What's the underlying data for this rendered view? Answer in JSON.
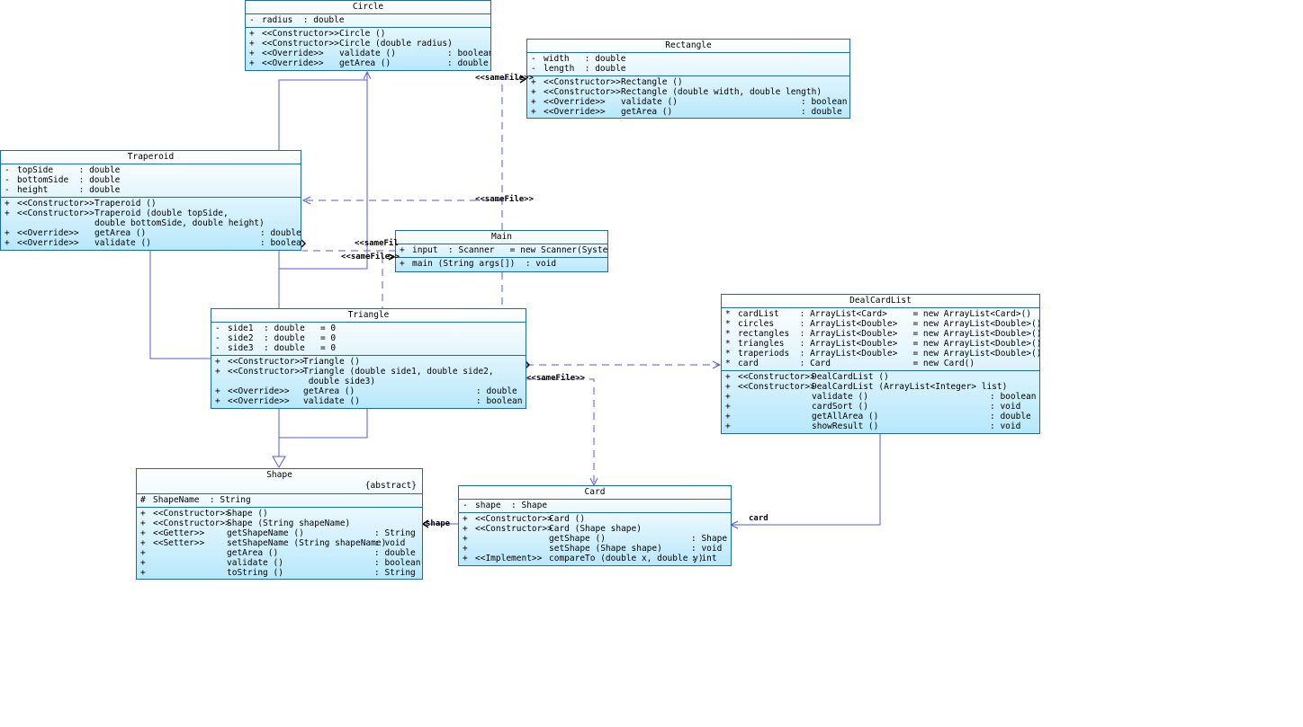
{
  "classes": {
    "circle": {
      "name": "Circle",
      "fields": [
        [
          "-",
          "radius  : double"
        ]
      ],
      "methods": [
        [
          "+",
          "<<Constructor>>",
          "Circle ()",
          ""
        ],
        [
          "+",
          "<<Constructor>>",
          "Circle (double radius)",
          ""
        ],
        [
          "+",
          "<<Override>>",
          "validate ()",
          ": boolean"
        ],
        [
          "+",
          "<<Override>>",
          "getArea ()",
          ": double"
        ]
      ]
    },
    "rectangle": {
      "name": "Rectangle",
      "fields": [
        [
          "-",
          "width   : double"
        ],
        [
          "-",
          "length  : double"
        ]
      ],
      "methods": [
        [
          "+",
          "<<Constructor>>",
          "Rectangle ()",
          ""
        ],
        [
          "+",
          "<<Constructor>>",
          "Rectangle (double width, double length)",
          ""
        ],
        [
          "+",
          "<<Override>>",
          "validate ()",
          ": boolean"
        ],
        [
          "+",
          "<<Override>>",
          "getArea ()",
          ": double"
        ]
      ]
    },
    "traperoid": {
      "name": "Traperoid",
      "fields": [
        [
          "-",
          "topSide     : double"
        ],
        [
          "-",
          "bottomSide  : double"
        ],
        [
          "-",
          "height      : double"
        ]
      ],
      "methods": [
        [
          "+",
          "<<Constructor>>",
          "Traperoid ()",
          ""
        ],
        [
          "+",
          "<<Constructor>>",
          "Traperoid (double topSide,",
          ""
        ],
        [
          "",
          "",
          "double bottomSide, double height)",
          ""
        ],
        [
          "+",
          "<<Override>>",
          "getArea ()",
          ": double"
        ],
        [
          "+",
          "<<Override>>",
          "validate ()",
          ": boolean"
        ]
      ]
    },
    "main": {
      "name": "Main",
      "fields": [
        [
          "+",
          "input  : Scanner   = new Scanner(System.in)"
        ]
      ],
      "methods": [
        [
          "+",
          "",
          "main (String args[])  : void",
          ""
        ]
      ]
    },
    "triangle": {
      "name": "Triangle",
      "fields": [
        [
          "-",
          "side1  : double   = 0"
        ],
        [
          "-",
          "side2  : double   = 0"
        ],
        [
          "-",
          "side3  : double   = 0"
        ]
      ],
      "methods": [
        [
          "+",
          "<<Constructor>>",
          "Triangle ()",
          ""
        ],
        [
          "+",
          "<<Constructor>>",
          "Triangle (double side1, double side2,",
          ""
        ],
        [
          "",
          "",
          " double side3)",
          ""
        ],
        [
          "+",
          "<<Override>>",
          "getArea ()",
          ": double"
        ],
        [
          "+",
          "<<Override>>",
          "validate ()",
          ": boolean"
        ]
      ]
    },
    "dealcardlist": {
      "name": "DealCardList",
      "fields": [
        [
          "*",
          "cardList    : ArrayList<Card>     = new ArrayList<Card>()"
        ],
        [
          "*",
          "circles     : ArrayList<Double>   = new ArrayList<Double>()"
        ],
        [
          "*",
          "rectangles  : ArrayList<Double>   = new ArrayList<Double>()"
        ],
        [
          "*",
          "triangles   : ArrayList<Double>   = new ArrayList<Double>()"
        ],
        [
          "*",
          "traperiods  : ArrayList<Double>   = new ArrayList<Double>()"
        ],
        [
          "*",
          "card        : Card                = new Card()"
        ]
      ],
      "methods": [
        [
          "+",
          "<<Constructor>>",
          "DealCardList ()",
          ""
        ],
        [
          "+",
          "<<Constructor>>",
          "DealCardList (ArrayList<Integer> list)",
          ""
        ],
        [
          "+",
          "",
          "validate ()",
          ": boolean"
        ],
        [
          "+",
          "",
          "cardSort ()",
          ": void"
        ],
        [
          "+",
          "",
          "getAllArea ()",
          ": double"
        ],
        [
          "+",
          "",
          "showResult ()",
          ": void"
        ]
      ]
    },
    "shape": {
      "name": "Shape",
      "stereotype": "{abstract}",
      "fields": [
        [
          "#",
          "ShapeName  : String"
        ]
      ],
      "methods": [
        [
          "+",
          "<<Constructor>>",
          "Shape ()",
          ""
        ],
        [
          "+",
          "<<Constructor>>",
          "Shape (String shapeName)",
          ""
        ],
        [
          "+",
          "<<Getter>>",
          "getShapeName ()",
          ": String"
        ],
        [
          "+",
          "<<Setter>>",
          "setShapeName (String shapeName)",
          ": void"
        ],
        [
          "+",
          "",
          "getArea ()",
          ": double"
        ],
        [
          "+",
          "",
          "validate ()",
          ": boolean"
        ],
        [
          "+",
          "",
          "toString ()",
          ": String"
        ]
      ]
    },
    "card": {
      "name": "Card",
      "fields": [
        [
          "-",
          "shape  : Shape"
        ]
      ],
      "methods": [
        [
          "+",
          "<<Constructor>>",
          "Card ()",
          ""
        ],
        [
          "+",
          "<<Constructor>>",
          "Card (Shape shape)",
          ""
        ],
        [
          "+",
          "",
          "getShape ()",
          ": Shape"
        ],
        [
          "+",
          "",
          "setShape (Shape shape)",
          ": void"
        ],
        [
          "+",
          "<<Implement>>",
          "compareTo (double x, double y)",
          ": int"
        ]
      ]
    }
  },
  "labels": {
    "samefile_rect": "<<sameFile>>",
    "samefile_trap": "<<sameFile>>",
    "samefile_main1": "<<sameFil",
    "samefile_main2": "<<sameFile>>",
    "samefile_tri": "<<sameFile>>",
    "shape_assoc": "shape",
    "card_assoc": "card"
  }
}
